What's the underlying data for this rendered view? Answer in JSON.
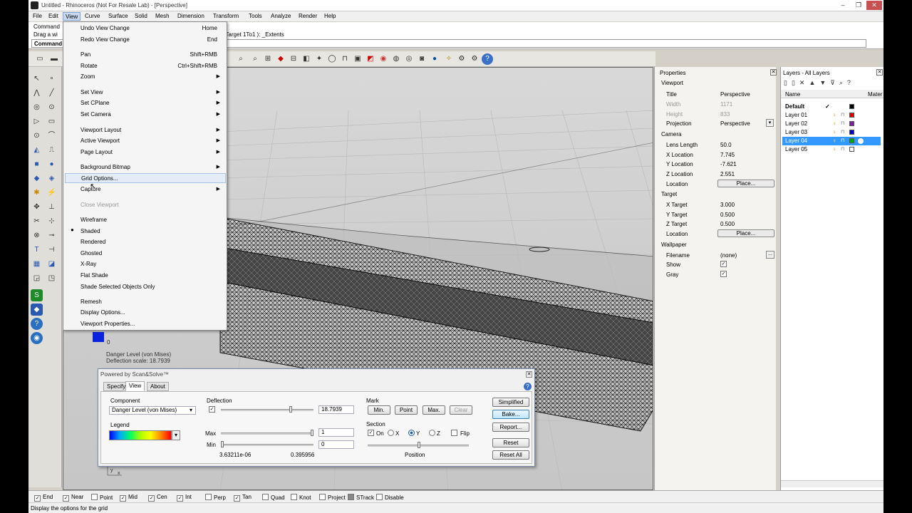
{
  "window": {
    "title": "Untitled - Rhinoceros (Not For Resale Lab) - [Perspective]",
    "minimize": "–",
    "maximize": "❐",
    "close": "✕"
  },
  "menubar": [
    "File",
    "Edit",
    "View",
    "Curve",
    "Surface",
    "Solid",
    "Mesh",
    "Dimension",
    "Transform",
    "Tools",
    "Analyze",
    "Render",
    "Help"
  ],
  "command": {
    "line1": "Command",
    "line2": "Drag a wi",
    "line2_tail": "d  Target  1To1 ):  _Extents",
    "prompt": "Command"
  },
  "view_menu": {
    "items": [
      {
        "label": "Undo View Change",
        "shortcut": "Home"
      },
      {
        "label": "Redo View Change",
        "shortcut": "End"
      },
      {
        "label": "Pan",
        "shortcut": "Shift+RMB"
      },
      {
        "label": "Rotate",
        "shortcut": "Ctrl+Shift+RMB"
      },
      {
        "label": "Zoom",
        "arrow": "▶"
      },
      {
        "label": "Set View",
        "arrow": "▶"
      },
      {
        "label": "Set CPlane",
        "arrow": "▶"
      },
      {
        "label": "Set Camera",
        "arrow": "▶"
      },
      {
        "label": "Viewport Layout",
        "arrow": "▶"
      },
      {
        "label": "Active Viewport",
        "arrow": "▶"
      },
      {
        "label": "Page Layout",
        "arrow": "▶"
      },
      {
        "label": "Background Bitmap",
        "arrow": "▶"
      },
      {
        "label": "Grid Options..."
      },
      {
        "label": "Capture",
        "arrow": "▶"
      },
      {
        "label": "Close Viewport"
      },
      {
        "label": "Wireframe"
      },
      {
        "label": "Shaded",
        "bullet": "●"
      },
      {
        "label": "Rendered"
      },
      {
        "label": "Ghosted"
      },
      {
        "label": "X-Ray"
      },
      {
        "label": "Flat Shade"
      },
      {
        "label": "Shade Selected Objects Only"
      },
      {
        "label": "Remesh"
      },
      {
        "label": "Display Options..."
      },
      {
        "label": "Viewport Properties..."
      }
    ]
  },
  "viewport": {
    "legend_label": "Danger Level (von Mises)",
    "deflection_scale": "Deflection scale: 18.7939",
    "scale_zero": "0",
    "axis_y": "y",
    "axis_x": "x"
  },
  "properties": {
    "title": "Properties",
    "viewport_header": "Viewport",
    "title_label": "Title",
    "title_value": "Perspective",
    "width_label": "Width",
    "width_value": "1171",
    "height_label": "Height",
    "height_value": "833",
    "projection_label": "Projection",
    "projection_value": "Perspective",
    "camera_header": "Camera",
    "lens_label": "Lens Length",
    "lens_value": "50.0",
    "xloc_label": "X Location",
    "xloc_value": "7.745",
    "yloc_label": "Y Location",
    "yloc_value": "-7.621",
    "zloc_label": "Z Location",
    "zloc_value": "2.551",
    "location_label": "Location",
    "place_button": "Place...",
    "target_header": "Target",
    "xt_label": "X Target",
    "xt_value": "3.000",
    "yt_label": "Y Target",
    "yt_value": "0.500",
    "zt_label": "Z Target",
    "zt_value": "0.500",
    "tlocation_label": "Location",
    "tplace_button": "Place...",
    "wallpaper_header": "Wallpaper",
    "filename_label": "Filename",
    "filename_value": "(none)",
    "browse_button": "...",
    "show_label": "Show",
    "gray_label": "Gray",
    "check_mark": "✓"
  },
  "layers": {
    "title": "Layers - All Layers",
    "col_name": "Name",
    "col_material": "Mater",
    "rows": [
      {
        "name": "Default",
        "color": "#000000",
        "current": "✓"
      },
      {
        "name": "Layer 01",
        "color": "#dd0000"
      },
      {
        "name": "Layer 02",
        "color": "#7a1fa0"
      },
      {
        "name": "Layer 03",
        "color": "#0000cc"
      },
      {
        "name": "Layer 04",
        "color": "#00aa00"
      },
      {
        "name": "Layer 05",
        "color": "#ffffff"
      }
    ]
  },
  "dialog": {
    "title": "Powered by Scan&Solve™",
    "tabs": [
      "Specify",
      "View",
      "About"
    ],
    "component_label": "Component",
    "component_value": "Danger Level (von Mises)",
    "legend_label": "Legend",
    "deflection_label": "Deflection",
    "deflection_value": "18.7939",
    "max_label": "Max",
    "max_value": "1",
    "min_label": "Min",
    "min_value": "0",
    "range_min": "3.63211e-06",
    "range_max": "0.395956",
    "mark_label": "Mark",
    "mark_buttons": [
      "Min.",
      "Point",
      "Max.",
      "Clear"
    ],
    "section_label": "Section",
    "section_on": "On",
    "section_x": "X",
    "section_y": "Y",
    "section_z": "Z",
    "section_flip": "Flip",
    "position_label": "Position",
    "simplified_button": "Simplified",
    "bake_button": "Bake...",
    "report_button": "Report...",
    "reset_button": "Reset",
    "reset_all_button": "Reset All",
    "help": "?",
    "close": "✕",
    "dropdown_arrow": "▾"
  },
  "osnap": [
    {
      "label": "End",
      "on": true
    },
    {
      "label": "Near",
      "on": true
    },
    {
      "label": "Point",
      "on": false
    },
    {
      "label": "Mid",
      "on": true
    },
    {
      "label": "Cen",
      "on": true
    },
    {
      "label": "Int",
      "on": true
    },
    {
      "label": "Perp",
      "on": false
    },
    {
      "label": "Tan",
      "on": true
    },
    {
      "label": "Quad",
      "on": false
    },
    {
      "label": "Knot",
      "on": false
    },
    {
      "label": "Project",
      "on": false
    },
    {
      "label": "STrack",
      "on": false
    },
    {
      "label": "Disable",
      "on": false
    }
  ],
  "status": "Display the options for the grid"
}
